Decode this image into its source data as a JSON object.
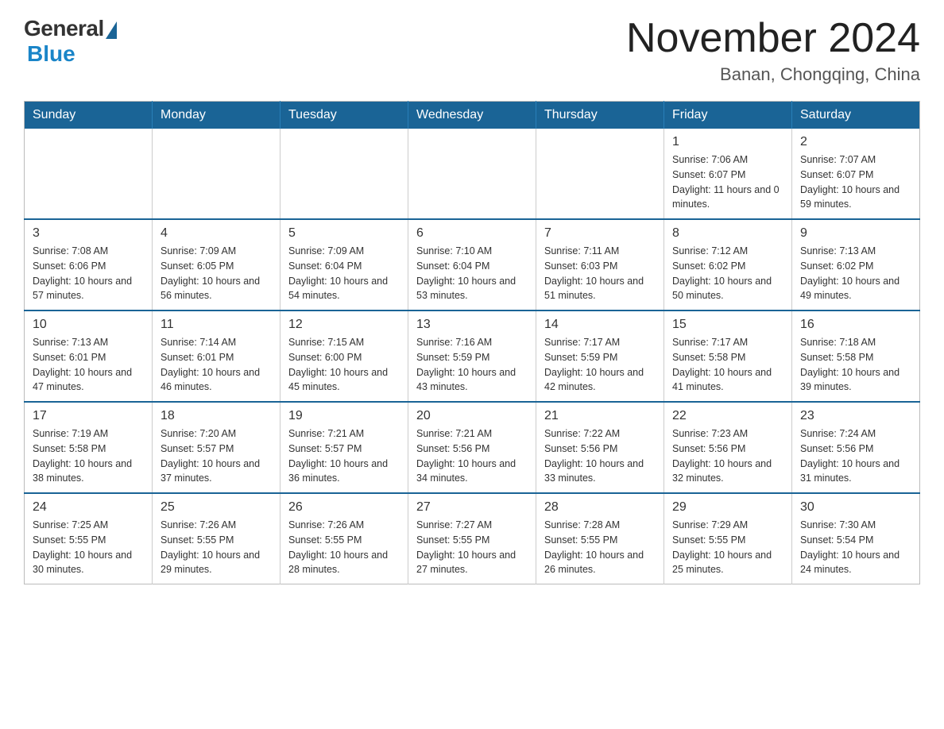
{
  "header": {
    "logo": {
      "general": "General",
      "blue": "Blue"
    },
    "title": "November 2024",
    "subtitle": "Banan, Chongqing, China"
  },
  "weekdays": [
    "Sunday",
    "Monday",
    "Tuesday",
    "Wednesday",
    "Thursday",
    "Friday",
    "Saturday"
  ],
  "weeks": [
    [
      {
        "day": "",
        "info": ""
      },
      {
        "day": "",
        "info": ""
      },
      {
        "day": "",
        "info": ""
      },
      {
        "day": "",
        "info": ""
      },
      {
        "day": "",
        "info": ""
      },
      {
        "day": "1",
        "info": "Sunrise: 7:06 AM\nSunset: 6:07 PM\nDaylight: 11 hours and 0 minutes."
      },
      {
        "day": "2",
        "info": "Sunrise: 7:07 AM\nSunset: 6:07 PM\nDaylight: 10 hours and 59 minutes."
      }
    ],
    [
      {
        "day": "3",
        "info": "Sunrise: 7:08 AM\nSunset: 6:06 PM\nDaylight: 10 hours and 57 minutes."
      },
      {
        "day": "4",
        "info": "Sunrise: 7:09 AM\nSunset: 6:05 PM\nDaylight: 10 hours and 56 minutes."
      },
      {
        "day": "5",
        "info": "Sunrise: 7:09 AM\nSunset: 6:04 PM\nDaylight: 10 hours and 54 minutes."
      },
      {
        "day": "6",
        "info": "Sunrise: 7:10 AM\nSunset: 6:04 PM\nDaylight: 10 hours and 53 minutes."
      },
      {
        "day": "7",
        "info": "Sunrise: 7:11 AM\nSunset: 6:03 PM\nDaylight: 10 hours and 51 minutes."
      },
      {
        "day": "8",
        "info": "Sunrise: 7:12 AM\nSunset: 6:02 PM\nDaylight: 10 hours and 50 minutes."
      },
      {
        "day": "9",
        "info": "Sunrise: 7:13 AM\nSunset: 6:02 PM\nDaylight: 10 hours and 49 minutes."
      }
    ],
    [
      {
        "day": "10",
        "info": "Sunrise: 7:13 AM\nSunset: 6:01 PM\nDaylight: 10 hours and 47 minutes."
      },
      {
        "day": "11",
        "info": "Sunrise: 7:14 AM\nSunset: 6:01 PM\nDaylight: 10 hours and 46 minutes."
      },
      {
        "day": "12",
        "info": "Sunrise: 7:15 AM\nSunset: 6:00 PM\nDaylight: 10 hours and 45 minutes."
      },
      {
        "day": "13",
        "info": "Sunrise: 7:16 AM\nSunset: 5:59 PM\nDaylight: 10 hours and 43 minutes."
      },
      {
        "day": "14",
        "info": "Sunrise: 7:17 AM\nSunset: 5:59 PM\nDaylight: 10 hours and 42 minutes."
      },
      {
        "day": "15",
        "info": "Sunrise: 7:17 AM\nSunset: 5:58 PM\nDaylight: 10 hours and 41 minutes."
      },
      {
        "day": "16",
        "info": "Sunrise: 7:18 AM\nSunset: 5:58 PM\nDaylight: 10 hours and 39 minutes."
      }
    ],
    [
      {
        "day": "17",
        "info": "Sunrise: 7:19 AM\nSunset: 5:58 PM\nDaylight: 10 hours and 38 minutes."
      },
      {
        "day": "18",
        "info": "Sunrise: 7:20 AM\nSunset: 5:57 PM\nDaylight: 10 hours and 37 minutes."
      },
      {
        "day": "19",
        "info": "Sunrise: 7:21 AM\nSunset: 5:57 PM\nDaylight: 10 hours and 36 minutes."
      },
      {
        "day": "20",
        "info": "Sunrise: 7:21 AM\nSunset: 5:56 PM\nDaylight: 10 hours and 34 minutes."
      },
      {
        "day": "21",
        "info": "Sunrise: 7:22 AM\nSunset: 5:56 PM\nDaylight: 10 hours and 33 minutes."
      },
      {
        "day": "22",
        "info": "Sunrise: 7:23 AM\nSunset: 5:56 PM\nDaylight: 10 hours and 32 minutes."
      },
      {
        "day": "23",
        "info": "Sunrise: 7:24 AM\nSunset: 5:56 PM\nDaylight: 10 hours and 31 minutes."
      }
    ],
    [
      {
        "day": "24",
        "info": "Sunrise: 7:25 AM\nSunset: 5:55 PM\nDaylight: 10 hours and 30 minutes."
      },
      {
        "day": "25",
        "info": "Sunrise: 7:26 AM\nSunset: 5:55 PM\nDaylight: 10 hours and 29 minutes."
      },
      {
        "day": "26",
        "info": "Sunrise: 7:26 AM\nSunset: 5:55 PM\nDaylight: 10 hours and 28 minutes."
      },
      {
        "day": "27",
        "info": "Sunrise: 7:27 AM\nSunset: 5:55 PM\nDaylight: 10 hours and 27 minutes."
      },
      {
        "day": "28",
        "info": "Sunrise: 7:28 AM\nSunset: 5:55 PM\nDaylight: 10 hours and 26 minutes."
      },
      {
        "day": "29",
        "info": "Sunrise: 7:29 AM\nSunset: 5:55 PM\nDaylight: 10 hours and 25 minutes."
      },
      {
        "day": "30",
        "info": "Sunrise: 7:30 AM\nSunset: 5:54 PM\nDaylight: 10 hours and 24 minutes."
      }
    ]
  ]
}
